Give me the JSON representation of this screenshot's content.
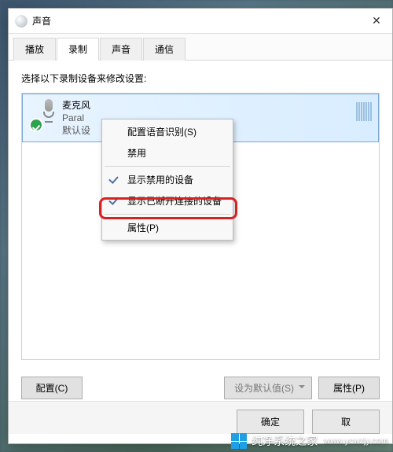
{
  "window": {
    "title": "声音"
  },
  "tabs": [
    {
      "label": "播放"
    },
    {
      "label": "录制"
    },
    {
      "label": "声音"
    },
    {
      "label": "通信"
    }
  ],
  "active_tab_index": 1,
  "instruction": "选择以下录制设备来修改设置:",
  "device": {
    "name": "麦克风",
    "subtitle": "Paral",
    "status": "默认设"
  },
  "context_menu": {
    "configure": "配置语音识别(S)",
    "disable": "禁用",
    "show_disabled": "显示禁用的设备",
    "show_disconnected": "显示已断开连接的设备",
    "properties": "属性(P)"
  },
  "buttons": {
    "configure": "配置(C)",
    "set_default": "设为默认值(S)",
    "properties": "属性(P)",
    "ok": "确定",
    "cancel": "取"
  },
  "watermark": {
    "brand": "纯净系统之家",
    "url": "www.ycwzjy.com"
  }
}
